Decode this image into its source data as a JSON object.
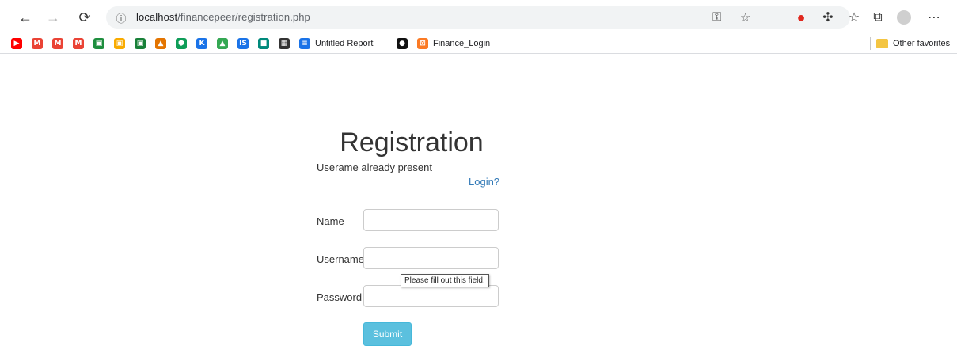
{
  "browser": {
    "url_host": "localhost",
    "url_path": "/financepeer/registration.php",
    "bookmarks": [
      {
        "icon": "youtube-icon",
        "color": "#ff0000",
        "glyph": "▶",
        "label": ""
      },
      {
        "icon": "gmail-icon",
        "color": "#ea4335",
        "glyph": "M",
        "label": ""
      },
      {
        "icon": "gmail-icon",
        "color": "#ea4335",
        "glyph": "M",
        "label": ""
      },
      {
        "icon": "gmail-icon",
        "color": "#ea4335",
        "glyph": "M",
        "label": ""
      },
      {
        "icon": "classroom-icon",
        "color": "#1e8e3e",
        "glyph": "▣",
        "label": ""
      },
      {
        "icon": "classroom-icon",
        "color": "#f9ab00",
        "glyph": "▣",
        "label": ""
      },
      {
        "icon": "classroom-icon",
        "color": "#188038",
        "glyph": "▣",
        "label": ""
      },
      {
        "icon": "ama-icon",
        "color": "#e37400",
        "glyph": "▲",
        "label": ""
      },
      {
        "icon": "hexagon-icon",
        "color": "#0f9d58",
        "glyph": "⬢",
        "label": ""
      },
      {
        "icon": "k-icon",
        "color": "#1a73e8",
        "glyph": "K",
        "label": ""
      },
      {
        "icon": "drive-icon",
        "color": "#34a853",
        "glyph": "▲",
        "label": ""
      },
      {
        "icon": "is-icon",
        "color": "#1a73e8",
        "glyph": "IS",
        "label": ""
      },
      {
        "icon": "meet-icon",
        "color": "#00897b",
        "glyph": "■",
        "label": ""
      },
      {
        "icon": "dark-app-icon",
        "color": "#333333",
        "glyph": "▦",
        "label": ""
      },
      {
        "icon": "report-icon",
        "color": "#1a73e8",
        "glyph": "≡",
        "label": "Untitled Report"
      },
      {
        "icon": "github-icon",
        "color": "#111111",
        "glyph": "●",
        "label": ""
      },
      {
        "icon": "xampp-icon",
        "color": "#fb7a24",
        "glyph": "⊠",
        "label": "Finance_Login"
      }
    ],
    "other_favorites": "Other favorites"
  },
  "page": {
    "title": "Registration",
    "message": "Userame already present",
    "login_link": "Login?",
    "fields": {
      "name_label": "Name",
      "username_label": "Username",
      "password_label": "Password"
    },
    "tooltip": "Please fill out this field.",
    "submit_label": "Submit"
  },
  "colors": {
    "submit_bg": "#5bc0de",
    "link": "#337ab7"
  }
}
